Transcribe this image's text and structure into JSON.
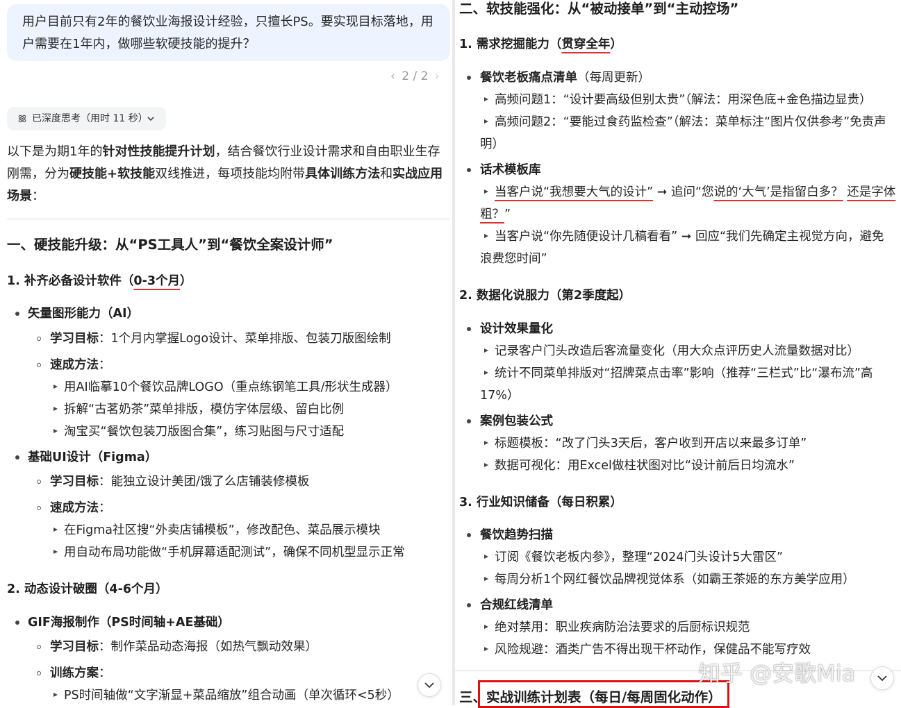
{
  "left": {
    "question": [
      "用户目前只有2年的餐饮业海报设计经验，只擅长PS。要实现目标落地，用",
      "户需要在1年内，做哪些软硬技能的提升？"
    ],
    "pager": "2 / 2",
    "thinking_chip": "已深度思考（用时 11 秒）",
    "intro": {
      "line1": [
        "以下是为期1年的",
        "针对性技能提升计划",
        "，结合餐饮行业设计需求和自由职业生存"
      ],
      "line2": [
        "刚需，分为",
        "硬技能+软技能",
        "双线推进，每项技能均附带",
        "具体训练方法",
        "和",
        "实战应用"
      ],
      "line3": [
        "场景",
        "："
      ]
    },
    "section1_title": "一、硬技能升级：从“PS工具人”到“餐饮全案设计师”",
    "s1_1": {
      "title": "1. 补齐必备设计软件（",
      "highlight": "0-3个月",
      "close": "）"
    },
    "ai": {
      "title": "矢量图形能力（AI）",
      "goal_label": "学习目标",
      "goal_text": "：1个月内掌握Logo设计、菜单排版、包装刀版图绘制",
      "method_label": "速成方法",
      "colon": "：",
      "items": [
        "用AI临摹10个餐饮品牌LOGO（重点练钢笔工具/形状生成器）",
        "拆解“古茗奶茶”菜单排版，模仿字体层级、留白比例",
        "淘宝买“餐饮包装刀版图合集”，练习贴图与尺寸适配"
      ]
    },
    "figma": {
      "title": "基础UI设计（Figma）",
      "goal_label": "学习目标",
      "goal_text": "：能独立设计美团/饿了么店铺装修模板",
      "method_label": "速成方法",
      "colon": "：",
      "items": [
        "在Figma社区搜“外卖店铺模板”，修改配色、菜品展示模块",
        "用自动布局功能做“手机屏幕适配测试”，确保不同机型显示正常"
      ]
    },
    "s1_2_title": "2. 动态设计破圈（4-6个月）",
    "gif": {
      "title": "GIF海报制作（PS时间轴+AE基础）",
      "goal_label": "学习目标",
      "goal_text": "：制作菜品动态海报（如热气飘动效果）",
      "plan_label": "训练方案",
      "colon": "：",
      "items": [
        "PS时间轴做“文字渐显+菜品缩放”组合动画（单次循环<5秒）"
      ]
    }
  },
  "right": {
    "section2_title": "二、软技能强化：从“被动接单”到“主动控场”",
    "s2_1": {
      "title": "1. 需求挖掘能力（",
      "highlight": "贯穿全年",
      "close": "）"
    },
    "pain": {
      "title": "餐饮老板痛点清单",
      "note": "（每周更新）",
      "item1": "高频问题1：“设计要高级但别太贵”（解法：用深色底+金色描边显贵）",
      "item2_line1": "高频问题2：“要能过食药监检查”（解法：菜单标注“图片仅供参考”免责声",
      "item2_line2": "明）"
    },
    "script": {
      "title": "话术模板库",
      "item1_a": "当客户说“我想要大气的设计”",
      "arrow": "➞",
      "item1_b": "追问“您",
      "item1_c": "说的‘大气’是指留白多？",
      "item1_d": "还是字体",
      "item1_e": "粗？",
      "item1_f": "”",
      "item2_line1": "当客户说“你先随便设计几稿看看”",
      "item2_b": "回应“我们先确定主视觉方向，避免",
      "item2_line2": "浪费您时间”"
    },
    "s2_2_title": "2. 数据化说服力（第2季度起）",
    "quant": {
      "title": "设计效果量化",
      "item1": "记录客户门头改造后客流量变化（用大众点评历史人流量数据对比）",
      "item2_line1": "统计不同菜单排版对“招牌菜点击率”影响（推荐“三栏式”比“瀑布流”高",
      "item2_line2": "17%）"
    },
    "case": {
      "title": "案例包装公式",
      "item1": "标题模板：“改了门头3天后，客户收到开店以来最多订单”",
      "item2": "数据可视化：用Excel做柱状图对比“设计前后日均流水”"
    },
    "s2_3_title": "3. 行业知识储备（每日积累）",
    "trend": {
      "title": "餐饮趋势扫描",
      "item1": "订阅《餐饮老板内参》，整理“2024门头设计5大雷区”",
      "item2": "每周分析1个网红餐饮品牌视觉体系（如霸王茶姬的东方美学应用）"
    },
    "redline": {
      "title": "合规红线清单",
      "item1": "绝对禁用：职业疾病防治法要求的后厨标识规范",
      "item2": "风险规避：酒类广告不得出现干杯动作，保健品不能写疗效"
    },
    "section3_prefix": "三、",
    "section3_title": "实战训练计划表（每日/每周固化动作）"
  },
  "watermark": "知乎 @安歌Mia"
}
